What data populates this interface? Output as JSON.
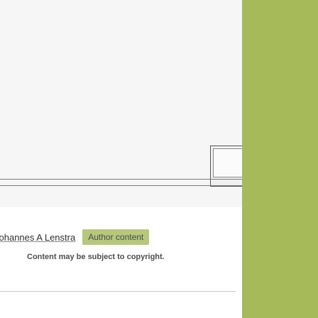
{
  "caption": {
    "author_name": "Johannes A Lenstra",
    "author_badge": "Author content",
    "copyright_notice": "Content may be subject to copyright."
  },
  "colors": {
    "side_panel": "#a6ba5a",
    "badge_bg": "#b7c87c"
  }
}
